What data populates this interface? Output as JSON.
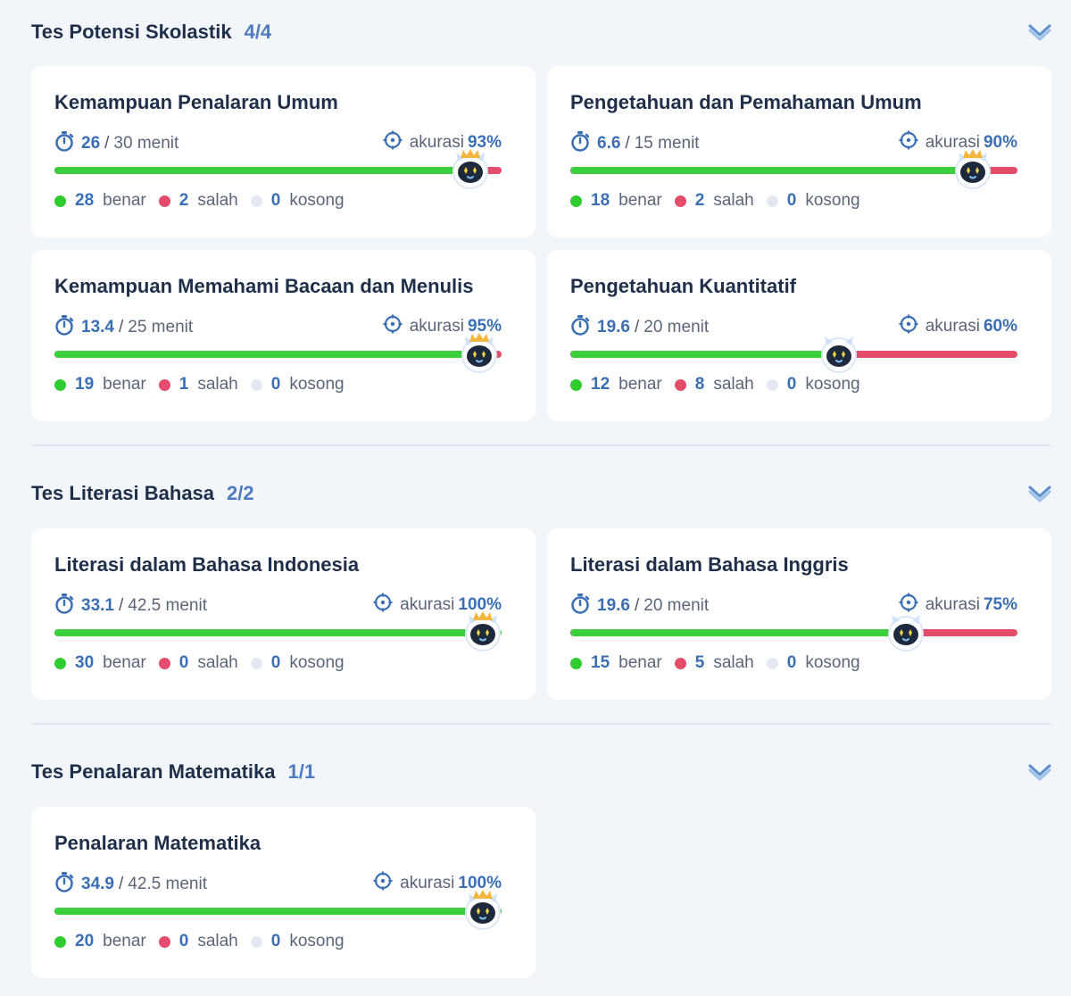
{
  "sections": [
    {
      "title": "Tes Potensi Skolastik",
      "count": "4/4",
      "cards": [
        {
          "title": "Kemampuan Penalaran Umum",
          "time": "26",
          "total": "30 menit",
          "acc_label": "akurasi",
          "acc": "93%",
          "accuracy_fraction": 0.93,
          "benar": "28",
          "salah": "2",
          "kosong": "0"
        },
        {
          "title": "Pengetahuan dan Pemahaman Umum",
          "time": "6.6",
          "total": "15 menit",
          "acc_label": "akurasi",
          "acc": "90%",
          "accuracy_fraction": 0.9,
          "benar": "18",
          "salah": "2",
          "kosong": "0"
        },
        {
          "title": "Kemampuan Memahami Bacaan dan Menulis",
          "time": "13.4",
          "total": "25 menit",
          "acc_label": "akurasi",
          "acc": "95%",
          "accuracy_fraction": 0.95,
          "benar": "19",
          "salah": "1",
          "kosong": "0"
        },
        {
          "title": "Pengetahuan Kuantitatif",
          "time": "19.6",
          "total": "20 menit",
          "acc_label": "akurasi",
          "acc": "60%",
          "accuracy_fraction": 0.6,
          "benar": "12",
          "salah": "8",
          "kosong": "0"
        }
      ]
    },
    {
      "title": "Tes Literasi Bahasa",
      "count": "2/2",
      "cards": [
        {
          "title": "Literasi dalam Bahasa Indonesia",
          "time": "33.1",
          "total": "42.5 menit",
          "acc_label": "akurasi",
          "acc": "100%",
          "accuracy_fraction": 1.0,
          "benar": "30",
          "salah": "0",
          "kosong": "0"
        },
        {
          "title": "Literasi dalam Bahasa Inggris",
          "time": "19.6",
          "total": "20 menit",
          "acc_label": "akurasi",
          "acc": "75%",
          "accuracy_fraction": 0.75,
          "benar": "15",
          "salah": "5",
          "kosong": "0"
        }
      ]
    },
    {
      "title": "Tes Penalaran Matematika",
      "count": "1/1",
      "cards": [
        {
          "title": "Penalaran Matematika",
          "time": "34.9",
          "total": "42.5 menit",
          "acc_label": "akurasi",
          "acc": "100%",
          "accuracy_fraction": 1.0,
          "benar": "20",
          "salah": "0",
          "kosong": "0"
        }
      ]
    }
  ],
  "labels": {
    "benar": "benar",
    "salah": "salah",
    "kosong": "kosong",
    "sep": "/"
  },
  "colors": {
    "correct": "#3ccf3c",
    "wrong": "#e34c6a",
    "empty": "#e3e9f1",
    "accent": "#3a6fb6",
    "background": "#f2f5f9",
    "card": "#ffffff"
  },
  "icons": {
    "time": "stopwatch-icon",
    "accuracy": "target-icon",
    "expand": "chevron-down-icon",
    "mascot": "mascot-icon"
  }
}
